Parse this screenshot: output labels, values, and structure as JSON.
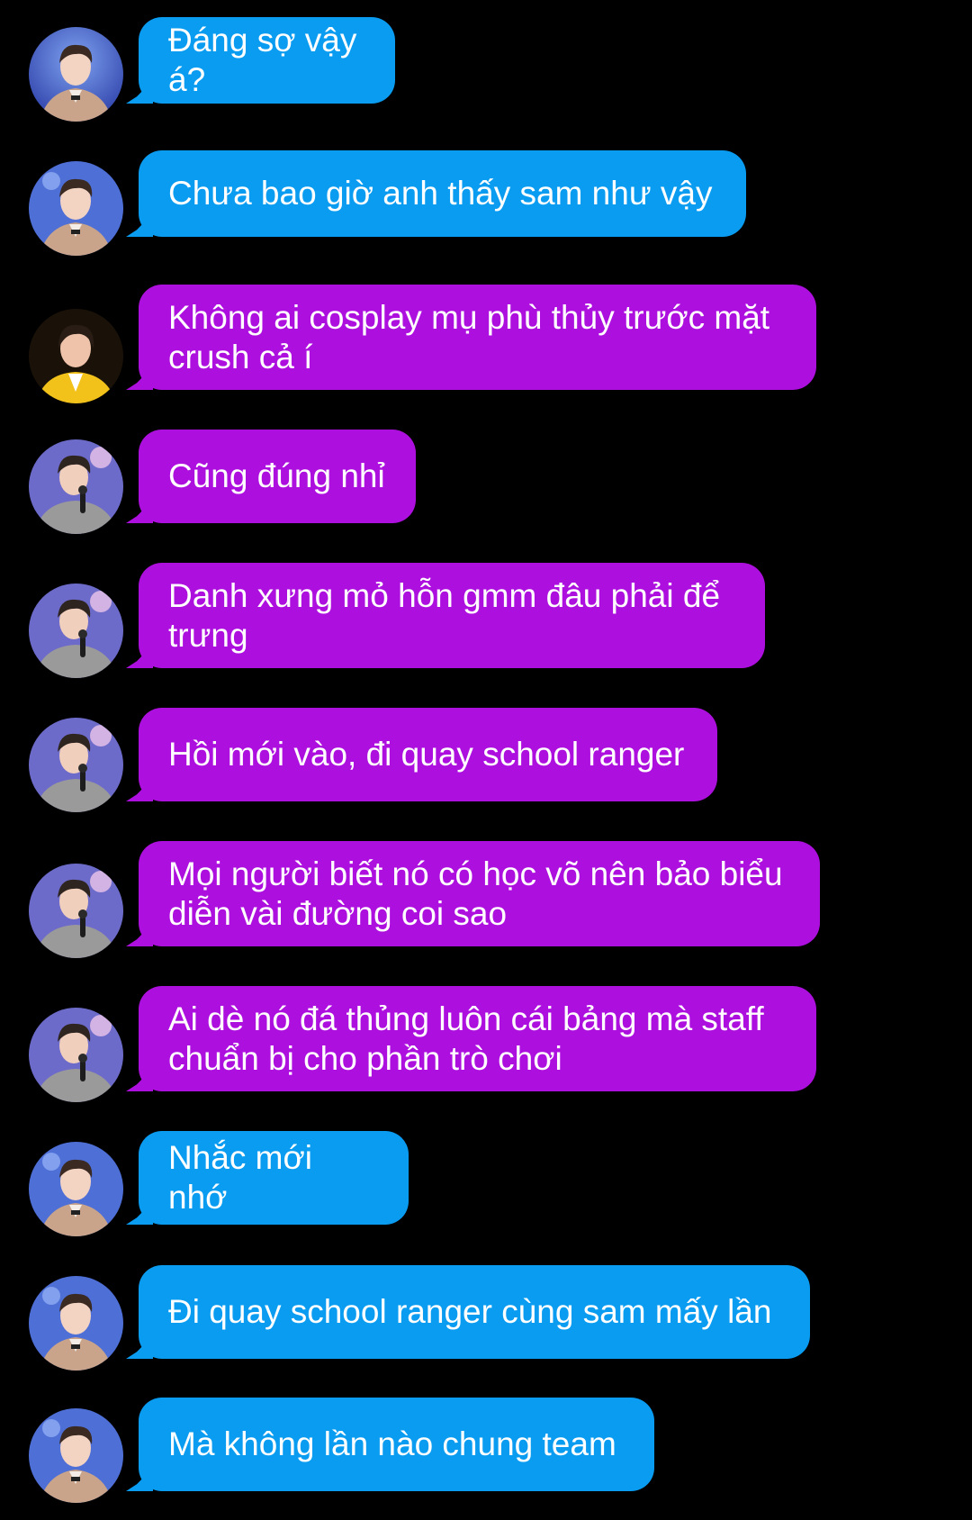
{
  "colors": {
    "background": "#000000",
    "bubble_blue": "#0a9cf1",
    "bubble_purple": "#ad10de",
    "text": "#ffffff"
  },
  "messages": [
    {
      "text": "Đáng sợ vậy á?",
      "bubble": "blue",
      "avatar": "avatar-suit"
    },
    {
      "text": "Chưa bao giờ anh thấy sam như vậy",
      "bubble": "blue",
      "avatar": "avatar-suit"
    },
    {
      "text": "Không ai cosplay mụ phù thủy trước mặt crush cả í",
      "bubble": "purple",
      "avatar": "avatar-yellow-jacket"
    },
    {
      "text": "Cũng đúng nhỉ",
      "bubble": "purple",
      "avatar": "avatar-stage-mic"
    },
    {
      "text": "Danh xưng mỏ hỗn gmm đâu phải để trưng",
      "bubble": "purple",
      "avatar": "avatar-stage-mic"
    },
    {
      "text": "Hồi mới vào, đi quay school ranger",
      "bubble": "purple",
      "avatar": "avatar-stage-mic"
    },
    {
      "text": "Mọi người biết nó có học võ nên bảo biểu diễn vài đường coi sao",
      "bubble": "purple",
      "avatar": "avatar-stage-mic"
    },
    {
      "text": "Ai dè nó đá thủng luôn cái bảng mà staff chuẩn bị cho phần trò chơi",
      "bubble": "purple",
      "avatar": "avatar-stage-mic"
    },
    {
      "text": "Nhắc mới nhớ",
      "bubble": "blue",
      "avatar": "avatar-suit"
    },
    {
      "text": "Đi quay school ranger cùng sam mấy lần",
      "bubble": "blue",
      "avatar": "avatar-suit"
    },
    {
      "text": "Mà không lần nào chung team",
      "bubble": "blue",
      "avatar": "avatar-suit"
    }
  ]
}
